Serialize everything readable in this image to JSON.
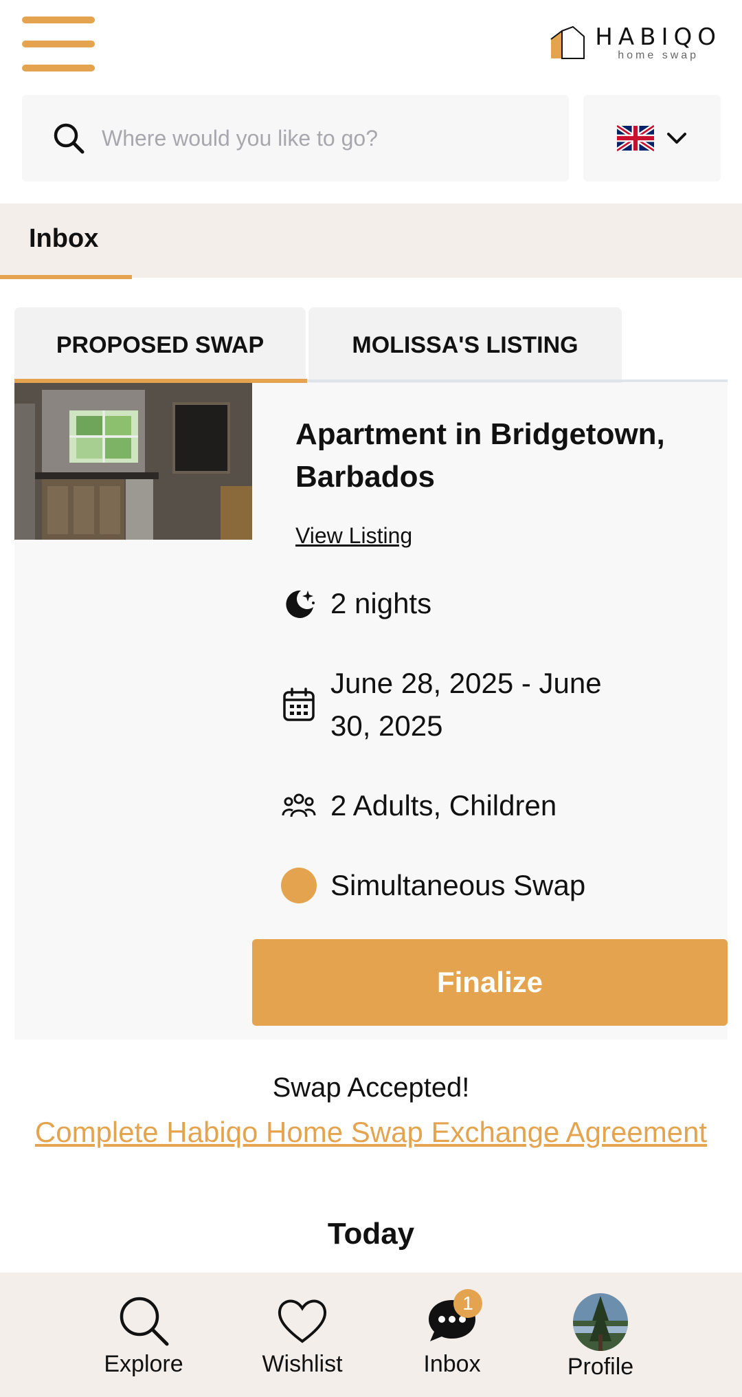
{
  "header": {
    "logo_name": "HABIQO",
    "logo_sub": "home swap"
  },
  "search": {
    "placeholder": "Where would you like to go?"
  },
  "language": {
    "flag": "uk-flag-icon"
  },
  "inbox": {
    "title": "Inbox"
  },
  "tabs": [
    {
      "label": "PROPOSED SWAP",
      "active": true
    },
    {
      "label": "MOLISSA'S LISTING",
      "active": false
    }
  ],
  "listing": {
    "title": "Apartment in Bridgetown, Barbados",
    "view_link": "View Listing",
    "nights": "2 nights",
    "dates": "June 28, 2025 - June 30, 2025",
    "guests": "2 Adults, Children",
    "swap_type": "Simultaneous Swap",
    "finalize_label": "Finalize"
  },
  "status": {
    "accepted": "Swap Accepted!",
    "agreement_link": "Complete Habiqo Home Swap Exchange Agreement",
    "day_separator": "Today"
  },
  "bottom_nav": [
    {
      "label": "Explore",
      "icon": "search-icon"
    },
    {
      "label": "Wishlist",
      "icon": "heart-icon"
    },
    {
      "label": "Inbox",
      "icon": "chat-bubble-icon",
      "badge": "1"
    },
    {
      "label": "Profile",
      "icon": "avatar"
    }
  ],
  "colors": {
    "accent": "#e4a44f",
    "bar_background": "#f3eeea",
    "card_background": "#f8f8f8"
  }
}
